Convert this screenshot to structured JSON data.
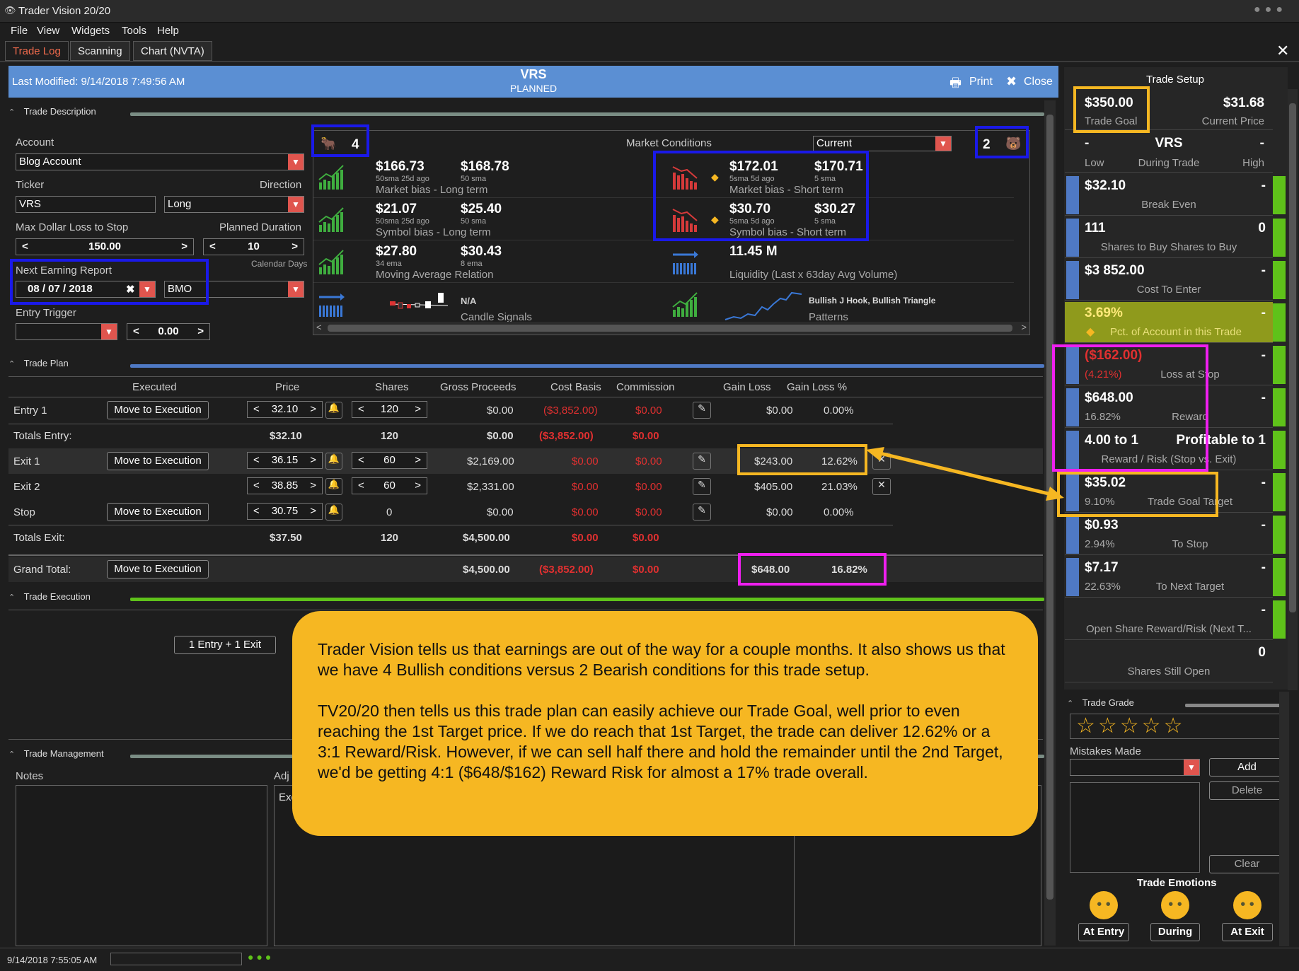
{
  "app": {
    "title": "Trader Vision 20/20"
  },
  "menu": [
    "File",
    "View",
    "Widgets",
    "Tools",
    "Help"
  ],
  "tabs": [
    "Trade Log",
    "Scanning",
    "Chart (NVTA)"
  ],
  "header": {
    "last_modified": "Last Modified: 9/14/2018 7:49:56 AM",
    "ticker": "VRS",
    "status": "PLANNED",
    "print": "Print",
    "close": "Close"
  },
  "trade_description": {
    "title": "Trade Description",
    "account_label": "Account",
    "account": "Blog Account",
    "ticker_label": "Ticker",
    "ticker": "VRS",
    "direction_label": "Direction",
    "direction": "Long",
    "max_loss_label": "Max Dollar Loss to Stop",
    "max_loss": "150.00",
    "duration_label": "Planned Duration",
    "duration": "10",
    "duration_unit": "Calendar Days",
    "earning_label": "Next Earning Report",
    "earning_date": "08  /  07  /  2018",
    "earning_time": "BMO",
    "entry_trigger_label": "Entry Trigger",
    "entry_trigger_value": "0.00"
  },
  "market_conditions": {
    "title": "Market Conditions",
    "selector": "Current",
    "bull_count": "4",
    "bear_count": "2",
    "rows": [
      {
        "v1": "$166.73",
        "s1": "50sma 25d ago",
        "v2": "$168.78",
        "s2": "50 sma",
        "label": "Market bias - Long term",
        "trend": "up"
      },
      {
        "v1": "$21.07",
        "s1": "50sma 25d ago",
        "v2": "$25.40",
        "s2": "50 sma",
        "label": "Symbol bias - Long term",
        "trend": "up"
      },
      {
        "v1": "$27.80",
        "s1": "34 ema",
        "v2": "$30.43",
        "s2": "8 ema",
        "label": "Moving Average Relation",
        "trend": "up"
      },
      {
        "v1": "N/A",
        "label": "Candle Signals",
        "trend": "flat"
      }
    ],
    "rows_right": [
      {
        "v1": "$172.01",
        "s1": "5sma 5d ago",
        "v2": "$170.71",
        "s2": "5 sma",
        "label": "Market bias - Short term",
        "trend": "down"
      },
      {
        "v1": "$30.70",
        "s1": "5sma 5d ago",
        "v2": "$30.27",
        "s2": "5 sma",
        "label": "Symbol bias - Short term",
        "trend": "down"
      },
      {
        "v1": "11.45 M",
        "label": "Liquidity (Last x 63day Avg Volume)",
        "trend": "flat"
      },
      {
        "v1": "Bullish J Hook, Bullish Triangle",
        "label": "Patterns",
        "trend": "up"
      }
    ]
  },
  "trade_plan": {
    "title": "Trade Plan",
    "columns": [
      "Executed",
      "Price",
      "Shares",
      "Gross Proceeds",
      "Cost Basis",
      "Commission",
      "Gain Loss",
      "Gain Loss %"
    ],
    "move_label": "Move to Execution",
    "rows": [
      {
        "label": "Entry 1",
        "price": "32.10",
        "shares": "120",
        "gross": "$0.00",
        "cost": "($3,852.00)",
        "comm": "$0.00",
        "gl": "$0.00",
        "glp": "0.00%"
      },
      {
        "label": "Totals Entry:",
        "price": "$32.10",
        "shares": "120",
        "gross": "$0.00",
        "cost": "($3,852.00)",
        "comm": "$0.00"
      },
      {
        "label": "Exit 1",
        "price": "36.15",
        "shares": "60",
        "gross": "$2,169.00",
        "cost": "$0.00",
        "comm": "$0.00",
        "gl": "$243.00",
        "glp": "12.62%"
      },
      {
        "label": "Exit 2",
        "price": "38.85",
        "shares": "60",
        "gross": "$2,331.00",
        "cost": "$0.00",
        "comm": "$0.00",
        "gl": "$405.00",
        "glp": "21.03%"
      },
      {
        "label": "Stop",
        "price": "30.75",
        "shares": "0",
        "gross": "$0.00",
        "cost": "$0.00",
        "comm": "$0.00",
        "gl": "$0.00",
        "glp": "0.00%"
      },
      {
        "label": "Totals Exit:",
        "price": "$37.50",
        "shares": "120",
        "gross": "$4,500.00",
        "cost": "$0.00",
        "comm": "$0.00"
      },
      {
        "label": "Grand Total:",
        "gross": "$4,500.00",
        "cost": "($3,852.00)",
        "comm": "$0.00",
        "gl": "$648.00",
        "glp": "16.82%"
      }
    ]
  },
  "trade_execution": {
    "title": "Trade Execution",
    "mode": "1 Entry + 1 Exit"
  },
  "trade_management": {
    "title": "Trade Management",
    "notes": "Notes",
    "adj": "Adj",
    "exe": "Exe"
  },
  "trade_setup": {
    "title": "Trade Setup",
    "goal": "$350.00",
    "goal_label": "Trade Goal",
    "price": "$31.68",
    "price_label": "Current Price",
    "ticker": "VRS",
    "low": "-",
    "high": "-",
    "low_label": "Low",
    "during_label": "During Trade",
    "high_label": "High",
    "cards": [
      {
        "v": "$32.10",
        "r": "-",
        "s": "Break Even"
      },
      {
        "v": "111",
        "r": "0",
        "s": "Shares to Buy       Shares to Buy"
      },
      {
        "v": "$3 852.00",
        "r": "-",
        "s": "Cost To Enter"
      },
      {
        "v": "3.69%",
        "r": "-",
        "s": "Pct. of Account in this Trade"
      },
      {
        "v": "($162.00)",
        "r": "-",
        "sub": "(4.21%)",
        "s": "Loss at Stop"
      },
      {
        "v": "$648.00",
        "r": "-",
        "sub": "16.82%",
        "s": "Reward"
      },
      {
        "v": "4.00 to 1",
        "r": "Profitable to 1",
        "s": "Reward / Risk (Stop vs. Exit)"
      },
      {
        "v": "$35.02",
        "r": "-",
        "sub": "9.10%",
        "s": "Trade Goal Target"
      },
      {
        "v": "$0.93",
        "r": "-",
        "sub": "2.94%",
        "s": "To Stop"
      },
      {
        "v": "$7.17",
        "r": "-",
        "sub": "22.63%",
        "s": "To Next Target"
      },
      {
        "v": "",
        "r": "-",
        "s": "Open Share Reward/Risk (Next T..."
      },
      {
        "v": "",
        "r": "0",
        "s": "Shares Still Open"
      }
    ]
  },
  "trade_grade": {
    "title": "Trade Grade",
    "stars": "☆☆☆☆☆",
    "mistakes_label": "Mistakes Made",
    "add": "Add",
    "delete": "Delete",
    "clear": "Clear",
    "emotions_label": "Trade Emotions",
    "at_entry": "At Entry",
    "during": "During",
    "at_exit": "At Exit"
  },
  "callout": {
    "p1": "Trader Vision tells us that earnings are out of the way for a couple months.  It also shows us that we have 4 Bullish conditions versus 2 Bearish conditions for this trade setup.",
    "p2": "TV20/20 then tells us this trade plan can easily achieve our Trade Goal, well prior to even reaching the 1st Target price.  If we do reach that 1st Target, the trade can deliver 12.62% or a 3:1 Reward/Risk.  However, if we can sell half there and hold the remainder until the 2nd Target, we'd be getting 4:1 ($648/$162) Reward Risk for almost a 17% trade overall."
  },
  "status": {
    "timestamp": "9/14/2018 7:55:05 AM"
  },
  "colors": {
    "accent_blue": "#5b8fd3",
    "highlight_yellow": "#f6b722",
    "highlight_blue": "#1a19e8",
    "highlight_magenta": "#ef1ff0",
    "bull_green": "#5fc21a",
    "bear_red": "#e03030"
  }
}
